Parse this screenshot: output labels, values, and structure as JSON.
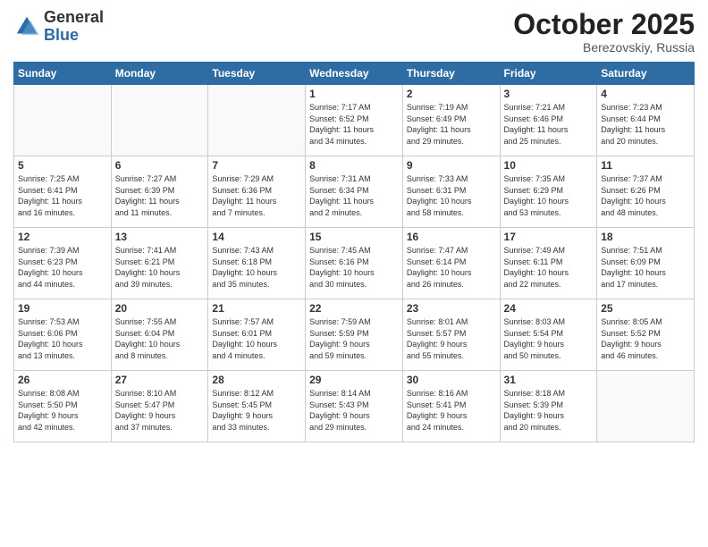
{
  "logo": {
    "general": "General",
    "blue": "Blue"
  },
  "header": {
    "title": "October 2025",
    "subtitle": "Berezovskiy, Russia"
  },
  "days_of_week": [
    "Sunday",
    "Monday",
    "Tuesday",
    "Wednesday",
    "Thursday",
    "Friday",
    "Saturday"
  ],
  "weeks": [
    [
      {
        "day": "",
        "info": ""
      },
      {
        "day": "",
        "info": ""
      },
      {
        "day": "",
        "info": ""
      },
      {
        "day": "1",
        "info": "Sunrise: 7:17 AM\nSunset: 6:52 PM\nDaylight: 11 hours\nand 34 minutes."
      },
      {
        "day": "2",
        "info": "Sunrise: 7:19 AM\nSunset: 6:49 PM\nDaylight: 11 hours\nand 29 minutes."
      },
      {
        "day": "3",
        "info": "Sunrise: 7:21 AM\nSunset: 6:46 PM\nDaylight: 11 hours\nand 25 minutes."
      },
      {
        "day": "4",
        "info": "Sunrise: 7:23 AM\nSunset: 6:44 PM\nDaylight: 11 hours\nand 20 minutes."
      }
    ],
    [
      {
        "day": "5",
        "info": "Sunrise: 7:25 AM\nSunset: 6:41 PM\nDaylight: 11 hours\nand 16 minutes."
      },
      {
        "day": "6",
        "info": "Sunrise: 7:27 AM\nSunset: 6:39 PM\nDaylight: 11 hours\nand 11 minutes."
      },
      {
        "day": "7",
        "info": "Sunrise: 7:29 AM\nSunset: 6:36 PM\nDaylight: 11 hours\nand 7 minutes."
      },
      {
        "day": "8",
        "info": "Sunrise: 7:31 AM\nSunset: 6:34 PM\nDaylight: 11 hours\nand 2 minutes."
      },
      {
        "day": "9",
        "info": "Sunrise: 7:33 AM\nSunset: 6:31 PM\nDaylight: 10 hours\nand 58 minutes."
      },
      {
        "day": "10",
        "info": "Sunrise: 7:35 AM\nSunset: 6:29 PM\nDaylight: 10 hours\nand 53 minutes."
      },
      {
        "day": "11",
        "info": "Sunrise: 7:37 AM\nSunset: 6:26 PM\nDaylight: 10 hours\nand 48 minutes."
      }
    ],
    [
      {
        "day": "12",
        "info": "Sunrise: 7:39 AM\nSunset: 6:23 PM\nDaylight: 10 hours\nand 44 minutes."
      },
      {
        "day": "13",
        "info": "Sunrise: 7:41 AM\nSunset: 6:21 PM\nDaylight: 10 hours\nand 39 minutes."
      },
      {
        "day": "14",
        "info": "Sunrise: 7:43 AM\nSunset: 6:18 PM\nDaylight: 10 hours\nand 35 minutes."
      },
      {
        "day": "15",
        "info": "Sunrise: 7:45 AM\nSunset: 6:16 PM\nDaylight: 10 hours\nand 30 minutes."
      },
      {
        "day": "16",
        "info": "Sunrise: 7:47 AM\nSunset: 6:14 PM\nDaylight: 10 hours\nand 26 minutes."
      },
      {
        "day": "17",
        "info": "Sunrise: 7:49 AM\nSunset: 6:11 PM\nDaylight: 10 hours\nand 22 minutes."
      },
      {
        "day": "18",
        "info": "Sunrise: 7:51 AM\nSunset: 6:09 PM\nDaylight: 10 hours\nand 17 minutes."
      }
    ],
    [
      {
        "day": "19",
        "info": "Sunrise: 7:53 AM\nSunset: 6:06 PM\nDaylight: 10 hours\nand 13 minutes."
      },
      {
        "day": "20",
        "info": "Sunrise: 7:55 AM\nSunset: 6:04 PM\nDaylight: 10 hours\nand 8 minutes."
      },
      {
        "day": "21",
        "info": "Sunrise: 7:57 AM\nSunset: 6:01 PM\nDaylight: 10 hours\nand 4 minutes."
      },
      {
        "day": "22",
        "info": "Sunrise: 7:59 AM\nSunset: 5:59 PM\nDaylight: 9 hours\nand 59 minutes."
      },
      {
        "day": "23",
        "info": "Sunrise: 8:01 AM\nSunset: 5:57 PM\nDaylight: 9 hours\nand 55 minutes."
      },
      {
        "day": "24",
        "info": "Sunrise: 8:03 AM\nSunset: 5:54 PM\nDaylight: 9 hours\nand 50 minutes."
      },
      {
        "day": "25",
        "info": "Sunrise: 8:05 AM\nSunset: 5:52 PM\nDaylight: 9 hours\nand 46 minutes."
      }
    ],
    [
      {
        "day": "26",
        "info": "Sunrise: 8:08 AM\nSunset: 5:50 PM\nDaylight: 9 hours\nand 42 minutes."
      },
      {
        "day": "27",
        "info": "Sunrise: 8:10 AM\nSunset: 5:47 PM\nDaylight: 9 hours\nand 37 minutes."
      },
      {
        "day": "28",
        "info": "Sunrise: 8:12 AM\nSunset: 5:45 PM\nDaylight: 9 hours\nand 33 minutes."
      },
      {
        "day": "29",
        "info": "Sunrise: 8:14 AM\nSunset: 5:43 PM\nDaylight: 9 hours\nand 29 minutes."
      },
      {
        "day": "30",
        "info": "Sunrise: 8:16 AM\nSunset: 5:41 PM\nDaylight: 9 hours\nand 24 minutes."
      },
      {
        "day": "31",
        "info": "Sunrise: 8:18 AM\nSunset: 5:39 PM\nDaylight: 9 hours\nand 20 minutes."
      },
      {
        "day": "",
        "info": ""
      }
    ]
  ]
}
